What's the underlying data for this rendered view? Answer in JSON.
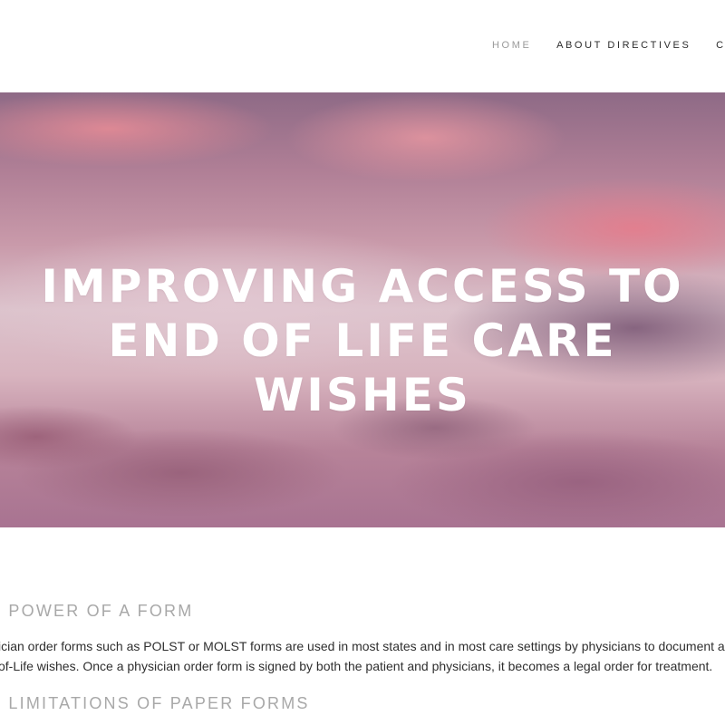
{
  "nav": {
    "items": [
      {
        "label": "HOME",
        "active": true
      },
      {
        "label": "ABOUT DIRECTIVES",
        "active": false
      },
      {
        "label": "CO",
        "active": false
      }
    ]
  },
  "hero": {
    "title_lines": [
      "IMPROVING ACCESS TO",
      "END OF LIFE CARE",
      "WISHES"
    ]
  },
  "content": {
    "section1_heading": "E POWER OF A FORM",
    "section1_text_lines": [
      "ician order forms such as POLST or MOLST forms  are used in most states and in most care settings by physicians to document a patient",
      "of-Life wishes. Once a physician order form is signed by both the patient and physicians, it becomes a legal order for treatment."
    ],
    "section2_heading": "E LIMITATIONS OF PAPER FORMS"
  },
  "colors": {
    "nav_active": "#9a9a9a",
    "nav_default": "#2c2c2c",
    "heading_gray": "#a8a8a8",
    "hero_text": "#ffffff"
  }
}
